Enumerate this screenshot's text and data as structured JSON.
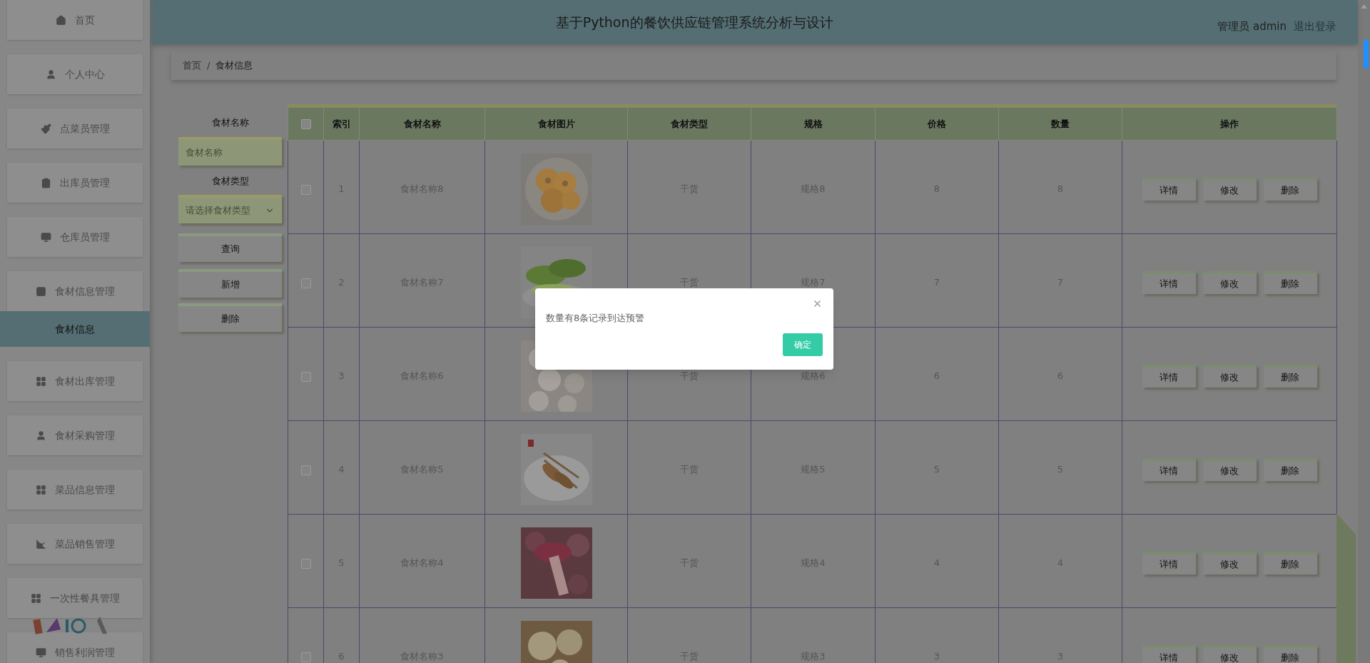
{
  "header": {
    "title": "基于Python的餐饮供应链管理系统分析与设计",
    "user": "管理员 admin",
    "logout": "退出登录"
  },
  "sidebar": {
    "items": [
      {
        "label": "首页",
        "selected": false
      },
      {
        "label": "个人中心",
        "selected": false
      },
      {
        "label": "点菜员管理",
        "selected": false
      },
      {
        "label": "出库员管理",
        "selected": false
      },
      {
        "label": "仓库员管理",
        "selected": false
      },
      {
        "label": "食材信息管理",
        "selected": false,
        "children": [
          {
            "label": "食材信息",
            "selected": true
          }
        ]
      },
      {
        "label": "食材出库管理",
        "selected": false
      },
      {
        "label": "食材采购管理",
        "selected": false
      },
      {
        "label": "菜品信息管理",
        "selected": false
      },
      {
        "label": "菜品销售管理",
        "selected": false
      },
      {
        "label": "一次性餐具管理",
        "selected": false
      },
      {
        "label": "销售利润管理",
        "selected": false
      }
    ]
  },
  "breadcrumb": {
    "items": [
      "首页",
      "食材信息"
    ],
    "separator": "/"
  },
  "search": {
    "fields": [
      {
        "label": "食材名称",
        "kind": "input",
        "placeholder": "食材名称"
      },
      {
        "label": "食材类型",
        "kind": "select",
        "placeholder": "请选择食材类型"
      }
    ],
    "buttons": [
      "查询",
      "新增",
      "删除"
    ]
  },
  "table": {
    "header_checked": false,
    "columns": [
      "索引",
      "食材名称",
      "食材图片",
      "食材类型",
      "规格",
      "价格",
      "数量",
      "操作"
    ],
    "rows": [
      {
        "checked": false,
        "index": "1",
        "name": "食材名称8",
        "type": "干货",
        "spec": "规格8",
        "price": "8",
        "quantity": "8",
        "actions": [
          "详情",
          "修改",
          "删除"
        ]
      },
      {
        "checked": false,
        "index": "2",
        "name": "食材名称7",
        "type": "干货",
        "spec": "规格7",
        "price": "7",
        "quantity": "7",
        "actions": [
          "详情",
          "修改",
          "删除"
        ]
      },
      {
        "checked": false,
        "index": "3",
        "name": "食材名称6",
        "type": "干货",
        "spec": "规格6",
        "price": "6",
        "quantity": "6",
        "actions": [
          "详情",
          "修改",
          "删除"
        ]
      },
      {
        "checked": false,
        "index": "4",
        "name": "食材名称5",
        "type": "干货",
        "spec": "规格5",
        "price": "5",
        "quantity": "5",
        "actions": [
          "详情",
          "修改",
          "删除"
        ]
      },
      {
        "checked": false,
        "index": "5",
        "name": "食材名称4",
        "type": "干货",
        "spec": "规格4",
        "price": "4",
        "quantity": "4",
        "actions": [
          "详情",
          "修改",
          "删除"
        ]
      },
      {
        "checked": false,
        "index": "6",
        "name": "食材名称3",
        "type": "干货",
        "spec": "规格3",
        "price": "3",
        "quantity": "3",
        "actions": [
          "详情",
          "修改",
          "删除"
        ]
      }
    ]
  },
  "dialog": {
    "message": "数量有8条记录到达预警",
    "button": "确定"
  }
}
